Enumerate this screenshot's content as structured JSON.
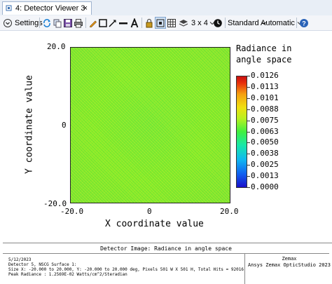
{
  "window": {
    "tab_title": "4: Detector Viewer 3",
    "tab_close": "×"
  },
  "toolbar": {
    "settings_label": "Settings",
    "layout_label": "3 x 4",
    "standard_label": "Standard",
    "automatic_label": "Automatic"
  },
  "plot": {
    "x_ticks": [
      "-20.0",
      "0",
      "20.0"
    ],
    "y_ticks": [
      "20.0",
      "0",
      "-20.0"
    ],
    "xlabel": "X coordinate value",
    "ylabel": "Y coordinate value",
    "colorbar_title_line1": "Radiance in",
    "colorbar_title_line2": "angle space",
    "colorbar_ticks": [
      "0.0126",
      "0.0113",
      "0.0101",
      "0.0088",
      "0.0075",
      "0.0063",
      "0.0050",
      "0.0038",
      "0.0025",
      "0.0013",
      "0.0000"
    ]
  },
  "chart_data": {
    "type": "heatmap",
    "title": "Detector Image: Radiance in angle space",
    "xlabel": "X coordinate value",
    "ylabel": "Y coordinate value",
    "xlim": [
      -20.0,
      20.0
    ],
    "ylim": [
      -20.0,
      20.0
    ],
    "colorbar_label": "Radiance in angle space",
    "colorbar_range": [
      0.0,
      0.0126
    ],
    "dominant_value_approx": 0.0063
  },
  "info_panel": {
    "title": "Detector Image: Radiance in angle space",
    "line1": "5/12/2023",
    "line2": "Detector 5, NSCG Surface 1:",
    "line3": "Size X: -20.000 to 20.000, Y: -20.000 to 20.000 deg, Pixels 501 W X 501 H, Total Hits = 92016",
    "line4": "Peak Radiance    : 1.2569E-02 Watts/cm^2/Steradian",
    "vendor": "Zemax",
    "product": "Ansys Zemax OpticStudio 2023"
  },
  "colors": {
    "plot_fill": "#8ded2e",
    "accent": "#1a5fb4"
  }
}
